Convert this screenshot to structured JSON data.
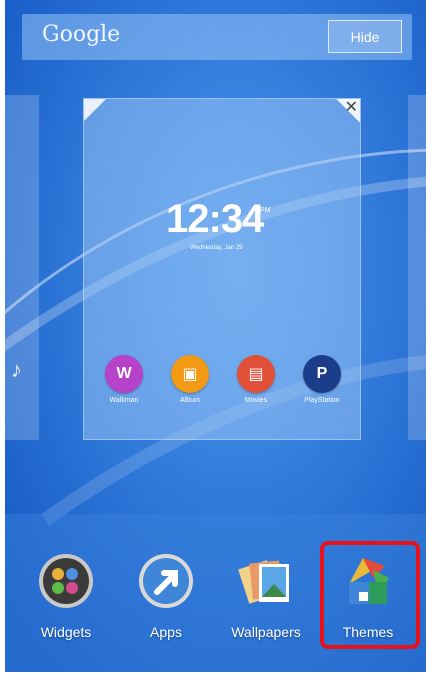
{
  "search_bar": {
    "label": "Google",
    "hide_label": "Hide"
  },
  "preview": {
    "clock_time": "12:34",
    "clock_ampm": "PM",
    "clock_date": "Wednesday, Jan 29",
    "apps": [
      {
        "label": "Walkman",
        "icon": "walkman-icon",
        "color": "#b542c9"
      },
      {
        "label": "Album",
        "icon": "album-icon",
        "color": "#f29a14"
      },
      {
        "label": "Movies",
        "icon": "movies-icon",
        "color": "#e2503a"
      },
      {
        "label": "PlayStation",
        "icon": "playstation-icon",
        "color": "#1c3d8a"
      }
    ]
  },
  "dock": {
    "items": [
      {
        "label": "Widgets",
        "icon": "widgets-icon"
      },
      {
        "label": "Apps",
        "icon": "apps-icon"
      },
      {
        "label": "Wallpapers",
        "icon": "wallpapers-icon"
      },
      {
        "label": "Themes",
        "icon": "themes-icon"
      }
    ]
  },
  "colors": {
    "background": "#1f6fd6",
    "highlight": "#e8121b"
  }
}
